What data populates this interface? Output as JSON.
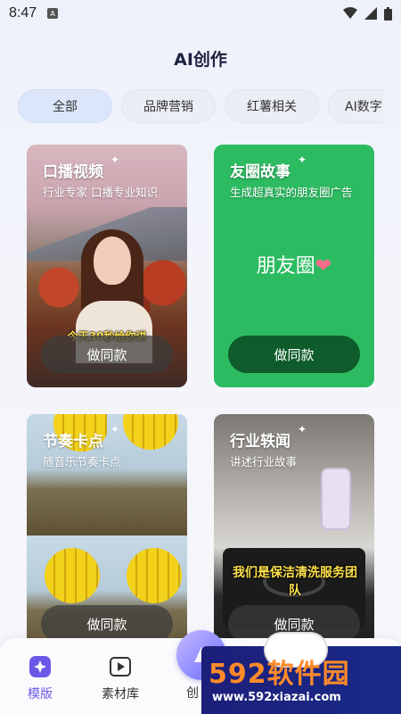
{
  "status_bar": {
    "time": "8:47"
  },
  "page_title": "AI创作",
  "tabs": [
    {
      "label": "全部"
    },
    {
      "label": "品牌营销"
    },
    {
      "label": "红薯相关"
    },
    {
      "label": "AI数字"
    }
  ],
  "cards": [
    {
      "title": "口播视频",
      "subtitle": "行业专家 口播专业知识",
      "caption": "今天30秒给你讲",
      "button": "做同款"
    },
    {
      "title": "友圈故事",
      "subtitle": "生成超真实的朋友圈广告",
      "center_text": "朋友圈",
      "button": "做同款"
    },
    {
      "title": "节奏卡点",
      "subtitle": "随音乐节奏卡点",
      "button": "做同款"
    },
    {
      "title": "行业轶闻",
      "subtitle": "讲述行业故事",
      "caption": "我们是保洁清洗服务团队",
      "button": "做同款"
    }
  ],
  "bottom_nav": {
    "items": [
      {
        "label": "模版",
        "icon": "sparkle-icon",
        "active": true
      },
      {
        "label": "素材库",
        "icon": "play-icon",
        "active": false
      },
      {
        "label": "创",
        "icon": "create-icon",
        "active": false
      }
    ]
  },
  "watermark": {
    "title": "592软件园",
    "url": "www.592xiazai.com"
  },
  "colors": {
    "accent": "#6a58e6",
    "green_card": "#2dbb62",
    "active_tab": "#dbe6fb"
  }
}
